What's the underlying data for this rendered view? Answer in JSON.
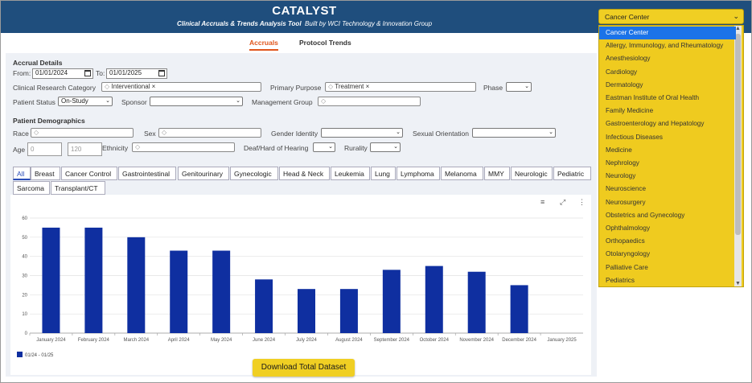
{
  "header": {
    "title": "CATALYST",
    "subtitle_main": "Clinical Accruals & Trends Analysis Tool",
    "subtitle_rest": "Built by WCI Technology & Innovation Group"
  },
  "tabs": [
    {
      "label": "Accruals",
      "active": true
    },
    {
      "label": "Protocol Trends",
      "active": false
    }
  ],
  "accrual": {
    "section_title": "Accrual Details",
    "from_label": "From:",
    "from_value": "01/01/2024",
    "to_label": "To:",
    "to_value": "01/01/2025",
    "category_label": "Clinical Research Category",
    "category_value": "Interventional ×",
    "purpose_label": "Primary Purpose",
    "purpose_value": "Treatment ×",
    "phase_label": "Phase",
    "phase_value": "",
    "status_label": "Patient Status",
    "status_value": "On-Study",
    "sponsor_label": "Sponsor",
    "sponsor_value": "",
    "mgmt_label": "Management Group",
    "mgmt_value": ""
  },
  "demographics": {
    "section_title": "Patient Demographics",
    "race_label": "Race",
    "sex_label": "Sex",
    "gender_label": "Gender Identity",
    "orientation_label": "Sexual Orientation",
    "age_label": "Age",
    "age_min_placeholder": "0",
    "age_max_placeholder": "120",
    "ethnicity_label": "Ethnicity",
    "deaf_label": "Deaf/Hard of Hearing",
    "rurality_label": "Rurality"
  },
  "disease_filters": [
    "All",
    "Breast",
    "Cancer Control",
    "Gastrointestinal",
    "Genitourinary",
    "Gynecologic",
    "Head & Neck",
    "Leukemia",
    "Lung",
    "Lymphoma",
    "Melanoma",
    "MMY",
    "Neurologic",
    "Pediatric",
    "Sarcoma",
    "Transplant/CT"
  ],
  "chart_toolbar": {
    "menu_icon": "≡",
    "expand_icon": "⤢",
    "more_icon": "⋮"
  },
  "chart_data": {
    "type": "bar",
    "categories": [
      "January 2024",
      "February 2024",
      "March 2024",
      "April 2024",
      "May 2024",
      "June 2024",
      "July 2024",
      "August 2024",
      "September 2024",
      "October 2024",
      "November 2024",
      "December 2024",
      "January 2025"
    ],
    "series": [
      {
        "name": "01/24 - 01/25",
        "values": [
          55,
          55,
          50,
          43,
          43,
          28,
          23,
          23,
          33,
          35,
          32,
          25,
          0
        ]
      }
    ],
    "ylim": [
      0,
      60
    ],
    "yticks": [
      0,
      10,
      20,
      30,
      40,
      50,
      60
    ],
    "bar_color": "#0f2fa0",
    "grid": true,
    "legend": "bottom-left"
  },
  "download_label": "Download Total Dataset",
  "dropdown": {
    "selected": "Cancer Center",
    "options": [
      "Cancer Center",
      "Allergy, Immunology, and Rheumatology",
      "Anesthesiology",
      "Cardiology",
      "Dermatology",
      "Eastman Institute of Oral Health",
      "Family Medicine",
      "Gastroenterology and Hepatology",
      "Infectious Diseases",
      "Medicine",
      "Nephrology",
      "Neurology",
      "Neuroscience",
      "Neurosurgery",
      "Obstetrics and Gynecology",
      "Ophthalmology",
      "Orthopaedics",
      "Otolaryngology",
      "Palliative Care",
      "Pediatrics"
    ]
  },
  "colors": {
    "header": "#1f4e7d",
    "accent": "#e0561c",
    "dropdown": "#f0cf23",
    "bar": "#0f2fa0"
  }
}
